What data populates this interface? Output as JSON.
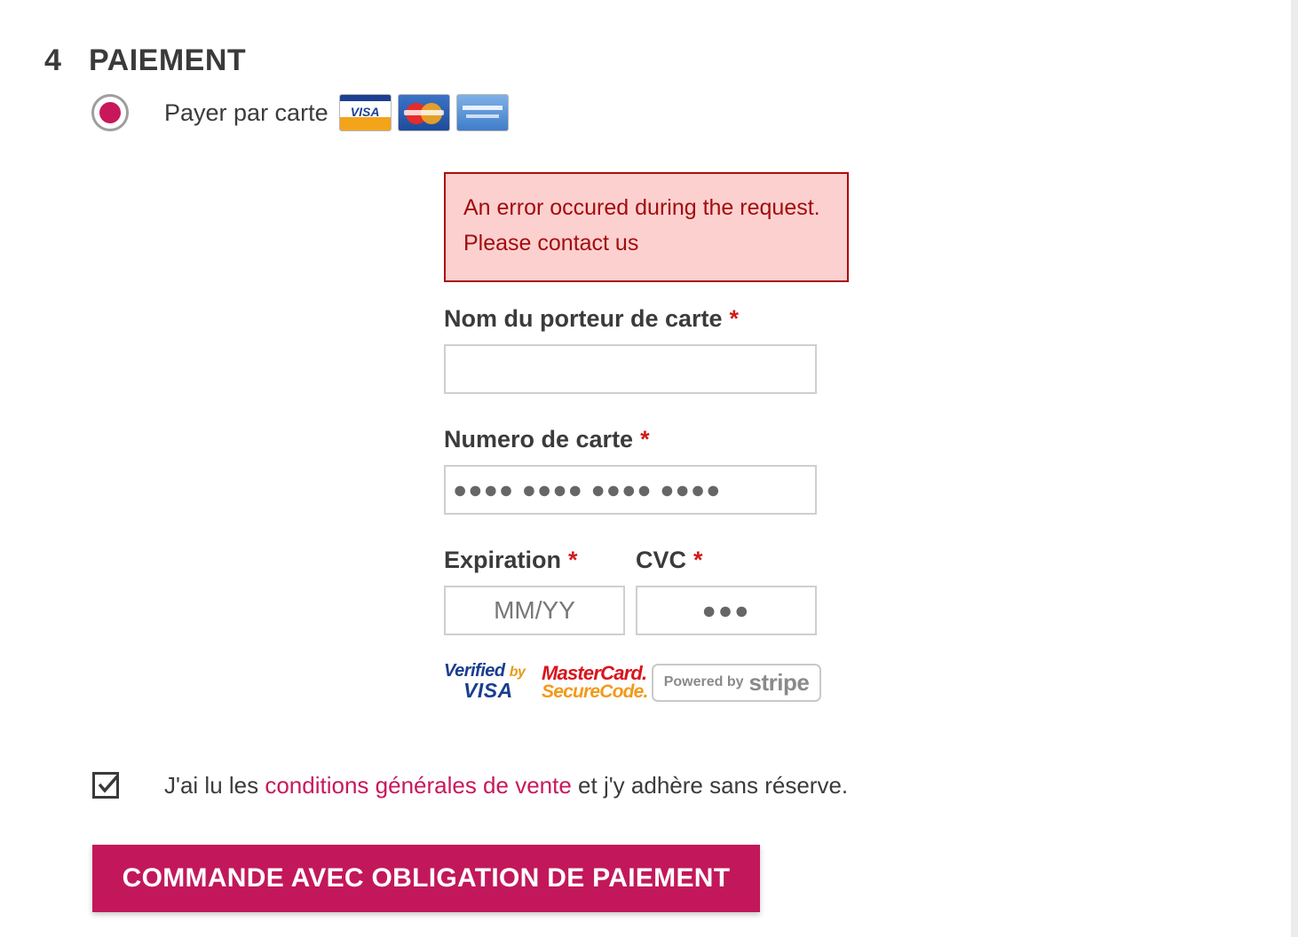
{
  "section": {
    "number": "4",
    "title": "PAIEMENT"
  },
  "payment_option": {
    "label": "Payer par carte",
    "selected": true,
    "card_icons": [
      "visa-card-icon",
      "mastercard-card-icon",
      "amex-card-icon"
    ],
    "visa_text": "VISA"
  },
  "error": {
    "message": "An error occured during the request. Please contact us"
  },
  "form": {
    "cardholder": {
      "label": "Nom du porteur de carte",
      "required_mark": "*",
      "value": ""
    },
    "card_number": {
      "label": "Numero de carte",
      "required_mark": "*",
      "placeholder": "●●●● ●●●● ●●●● ●●●●"
    },
    "expiration": {
      "label": "Expiration",
      "required_mark": "*",
      "placeholder": "MM/YY"
    },
    "cvc": {
      "label": "CVC",
      "required_mark": "*",
      "placeholder": "●●●"
    }
  },
  "badges": {
    "verified_by": "Verified",
    "verified_by_small": "by",
    "verified_visa": "VISA",
    "mastercard": "MasterCard.",
    "securecode": "SecureCode.",
    "powered_by": "Powered by",
    "stripe": "stripe"
  },
  "terms": {
    "checked": true,
    "prefix": "J'ai lu les ",
    "link": "conditions générales de vente",
    "suffix": " et j'y adhère sans réserve."
  },
  "submit": {
    "label": "COMMANDE AVEC OBLIGATION DE PAIEMENT"
  },
  "colors": {
    "accent": "#c2185b",
    "error_bg": "#fdd0d0",
    "error_border": "#a80f0f",
    "error_text": "#a20d0d",
    "required": "#d21a1a"
  }
}
